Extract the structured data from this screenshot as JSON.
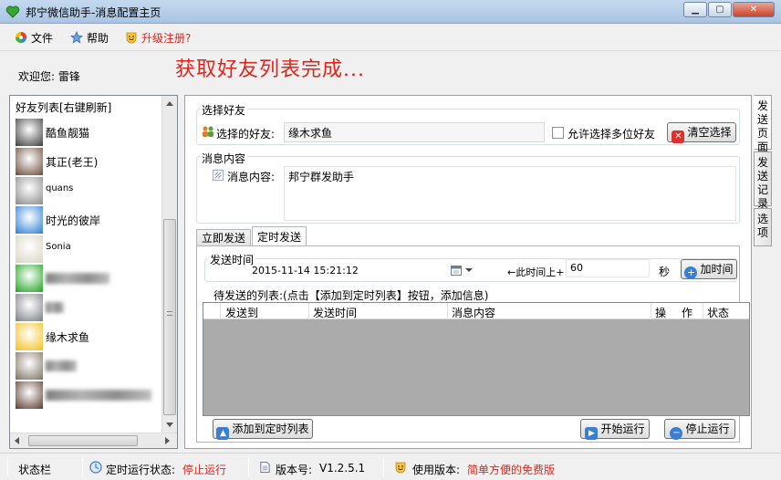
{
  "window": {
    "title": "邦宁微信助手-消息配置主页",
    "controls": [
      "minimize",
      "maximize",
      "close"
    ]
  },
  "menu": {
    "file": "文件",
    "help": "帮助",
    "upgrade": "升级注册?"
  },
  "welcome": {
    "label": "欢迎您:",
    "user": "雷锋"
  },
  "banner_message": "获取好友列表完成...",
  "friend_panel": {
    "header": "好友列表[右键刷新]",
    "friends": [
      {
        "name": "酷鱼靓猫",
        "obscured": false
      },
      {
        "name": "其正(老王)",
        "obscured": false
      },
      {
        "name": "quans",
        "obscured": false
      },
      {
        "name": "时光的彼岸",
        "obscured": false
      },
      {
        "name": "Sonia",
        "obscured": false
      },
      {
        "name": "",
        "obscured": true
      },
      {
        "name": "",
        "obscured": true
      },
      {
        "name": "缘木求鱼",
        "obscured": false
      },
      {
        "name": "",
        "obscured": true
      },
      {
        "name": "",
        "obscured": true
      }
    ]
  },
  "select_friend": {
    "group_title": "选择好友",
    "label": "选择的好友:",
    "value": "缘木求鱼",
    "allow_multi_label": "允许选择多位好友",
    "allow_multi_checked": false,
    "clear_button": "清空选择"
  },
  "message": {
    "group_title": "消息内容",
    "label": "消息内容:",
    "value": "邦宁群发助手"
  },
  "tabs": {
    "send_now": "立即发送",
    "scheduled": "定时发送",
    "active": "scheduled"
  },
  "schedule": {
    "group_title": "发送时间",
    "datetime": "2015-11-14  15:21:12",
    "offset_label": "←此时间上+",
    "offset_value": "60",
    "seconds_unit": "秒",
    "add_time_button": "加时间"
  },
  "queue": {
    "caption": "待发送的列表:(点击【添加到定时列表】按钮，添加信息)",
    "columns": [
      "发送到",
      "发送时间",
      "消息内容",
      "操",
      "作",
      "状态"
    ],
    "rows": []
  },
  "buttons": {
    "add_to_list": "添加到定时列表",
    "start": "开始运行",
    "stop": "停止运行"
  },
  "side_tabs": [
    "发送页面",
    "发送记录",
    "选项"
  ],
  "statusbar": {
    "label": "状态栏",
    "timer_label": "定时运行状态:",
    "timer_value": "停止运行",
    "version_label": "版本号:",
    "version_value": "V1.2.5.1",
    "edition_label": "使用版本:",
    "edition_value": "简单方便的免费版"
  },
  "colors": {
    "accent_red": "#e2231a",
    "title_bar": "#b5cde9",
    "grid_bg": "#ababab"
  }
}
